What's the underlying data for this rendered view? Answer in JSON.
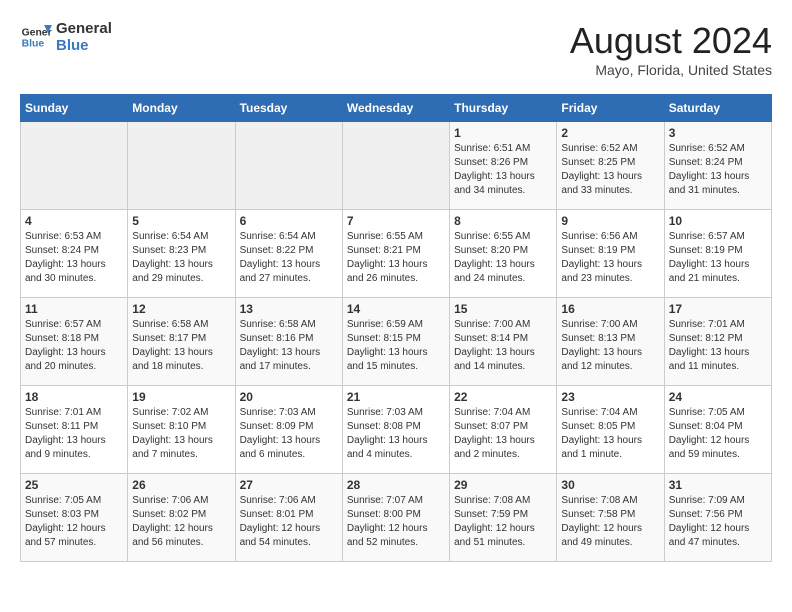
{
  "header": {
    "logo_line1": "General",
    "logo_line2": "Blue",
    "month_year": "August 2024",
    "location": "Mayo, Florida, United States"
  },
  "weekdays": [
    "Sunday",
    "Monday",
    "Tuesday",
    "Wednesday",
    "Thursday",
    "Friday",
    "Saturday"
  ],
  "weeks": [
    [
      {
        "day": "",
        "info": ""
      },
      {
        "day": "",
        "info": ""
      },
      {
        "day": "",
        "info": ""
      },
      {
        "day": "",
        "info": ""
      },
      {
        "day": "1",
        "info": "Sunrise: 6:51 AM\nSunset: 8:26 PM\nDaylight: 13 hours\nand 34 minutes."
      },
      {
        "day": "2",
        "info": "Sunrise: 6:52 AM\nSunset: 8:25 PM\nDaylight: 13 hours\nand 33 minutes."
      },
      {
        "day": "3",
        "info": "Sunrise: 6:52 AM\nSunset: 8:24 PM\nDaylight: 13 hours\nand 31 minutes."
      }
    ],
    [
      {
        "day": "4",
        "info": "Sunrise: 6:53 AM\nSunset: 8:24 PM\nDaylight: 13 hours\nand 30 minutes."
      },
      {
        "day": "5",
        "info": "Sunrise: 6:54 AM\nSunset: 8:23 PM\nDaylight: 13 hours\nand 29 minutes."
      },
      {
        "day": "6",
        "info": "Sunrise: 6:54 AM\nSunset: 8:22 PM\nDaylight: 13 hours\nand 27 minutes."
      },
      {
        "day": "7",
        "info": "Sunrise: 6:55 AM\nSunset: 8:21 PM\nDaylight: 13 hours\nand 26 minutes."
      },
      {
        "day": "8",
        "info": "Sunrise: 6:55 AM\nSunset: 8:20 PM\nDaylight: 13 hours\nand 24 minutes."
      },
      {
        "day": "9",
        "info": "Sunrise: 6:56 AM\nSunset: 8:19 PM\nDaylight: 13 hours\nand 23 minutes."
      },
      {
        "day": "10",
        "info": "Sunrise: 6:57 AM\nSunset: 8:19 PM\nDaylight: 13 hours\nand 21 minutes."
      }
    ],
    [
      {
        "day": "11",
        "info": "Sunrise: 6:57 AM\nSunset: 8:18 PM\nDaylight: 13 hours\nand 20 minutes."
      },
      {
        "day": "12",
        "info": "Sunrise: 6:58 AM\nSunset: 8:17 PM\nDaylight: 13 hours\nand 18 minutes."
      },
      {
        "day": "13",
        "info": "Sunrise: 6:58 AM\nSunset: 8:16 PM\nDaylight: 13 hours\nand 17 minutes."
      },
      {
        "day": "14",
        "info": "Sunrise: 6:59 AM\nSunset: 8:15 PM\nDaylight: 13 hours\nand 15 minutes."
      },
      {
        "day": "15",
        "info": "Sunrise: 7:00 AM\nSunset: 8:14 PM\nDaylight: 13 hours\nand 14 minutes."
      },
      {
        "day": "16",
        "info": "Sunrise: 7:00 AM\nSunset: 8:13 PM\nDaylight: 13 hours\nand 12 minutes."
      },
      {
        "day": "17",
        "info": "Sunrise: 7:01 AM\nSunset: 8:12 PM\nDaylight: 13 hours\nand 11 minutes."
      }
    ],
    [
      {
        "day": "18",
        "info": "Sunrise: 7:01 AM\nSunset: 8:11 PM\nDaylight: 13 hours\nand 9 minutes."
      },
      {
        "day": "19",
        "info": "Sunrise: 7:02 AM\nSunset: 8:10 PM\nDaylight: 13 hours\nand 7 minutes."
      },
      {
        "day": "20",
        "info": "Sunrise: 7:03 AM\nSunset: 8:09 PM\nDaylight: 13 hours\nand 6 minutes."
      },
      {
        "day": "21",
        "info": "Sunrise: 7:03 AM\nSunset: 8:08 PM\nDaylight: 13 hours\nand 4 minutes."
      },
      {
        "day": "22",
        "info": "Sunrise: 7:04 AM\nSunset: 8:07 PM\nDaylight: 13 hours\nand 2 minutes."
      },
      {
        "day": "23",
        "info": "Sunrise: 7:04 AM\nSunset: 8:05 PM\nDaylight: 13 hours\nand 1 minute."
      },
      {
        "day": "24",
        "info": "Sunrise: 7:05 AM\nSunset: 8:04 PM\nDaylight: 12 hours\nand 59 minutes."
      }
    ],
    [
      {
        "day": "25",
        "info": "Sunrise: 7:05 AM\nSunset: 8:03 PM\nDaylight: 12 hours\nand 57 minutes."
      },
      {
        "day": "26",
        "info": "Sunrise: 7:06 AM\nSunset: 8:02 PM\nDaylight: 12 hours\nand 56 minutes."
      },
      {
        "day": "27",
        "info": "Sunrise: 7:06 AM\nSunset: 8:01 PM\nDaylight: 12 hours\nand 54 minutes."
      },
      {
        "day": "28",
        "info": "Sunrise: 7:07 AM\nSunset: 8:00 PM\nDaylight: 12 hours\nand 52 minutes."
      },
      {
        "day": "29",
        "info": "Sunrise: 7:08 AM\nSunset: 7:59 PM\nDaylight: 12 hours\nand 51 minutes."
      },
      {
        "day": "30",
        "info": "Sunrise: 7:08 AM\nSunset: 7:58 PM\nDaylight: 12 hours\nand 49 minutes."
      },
      {
        "day": "31",
        "info": "Sunrise: 7:09 AM\nSunset: 7:56 PM\nDaylight: 12 hours\nand 47 minutes."
      }
    ]
  ]
}
